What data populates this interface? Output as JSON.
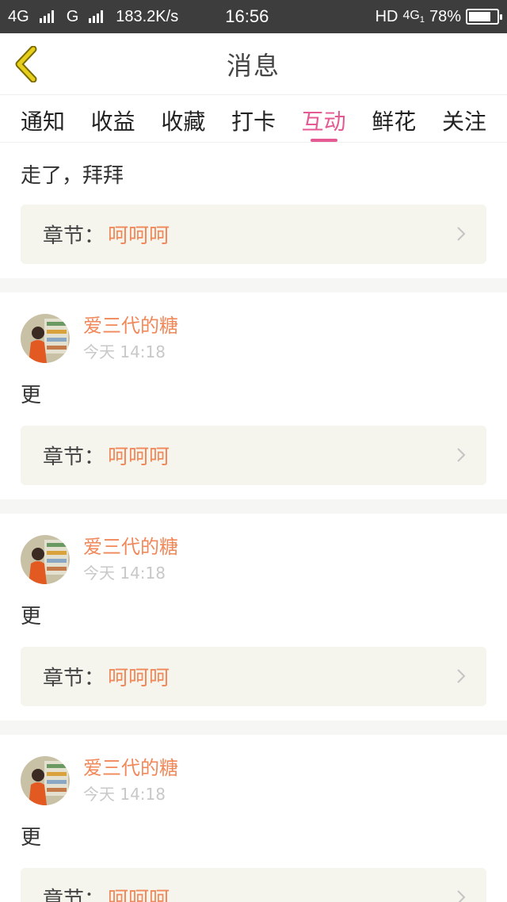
{
  "status_bar": {
    "network1": "4G",
    "network2": "G",
    "speed": "183.2K/s",
    "time": "16:56",
    "hd": "HD",
    "network3": "4G",
    "network3_sub": "1",
    "battery": "78%",
    "battery_level": 0.78
  },
  "header": {
    "title": "消息"
  },
  "tabs": [
    {
      "label": "通知"
    },
    {
      "label": "收益"
    },
    {
      "label": "收藏"
    },
    {
      "label": "打卡"
    },
    {
      "label": "互动",
      "active": true
    },
    {
      "label": "鲜花"
    },
    {
      "label": "关注"
    }
  ],
  "chapter_label": "章节：",
  "items": [
    {
      "text": "走了，拜拜",
      "chapter": "呵呵呵"
    },
    {
      "user": "爱三代的糖",
      "time": "今天 14:18",
      "text": "更",
      "chapter": "呵呵呵"
    },
    {
      "user": "爱三代的糖",
      "time": "今天 14:18",
      "text": "更",
      "chapter": "呵呵呵"
    },
    {
      "user": "爱三代的糖",
      "time": "今天 14:18",
      "text": "更",
      "chapter": "呵呵呵"
    }
  ],
  "colors": {
    "accent": "#e55a93",
    "name": "#f0885a",
    "back_arrow": "#c9b200"
  }
}
